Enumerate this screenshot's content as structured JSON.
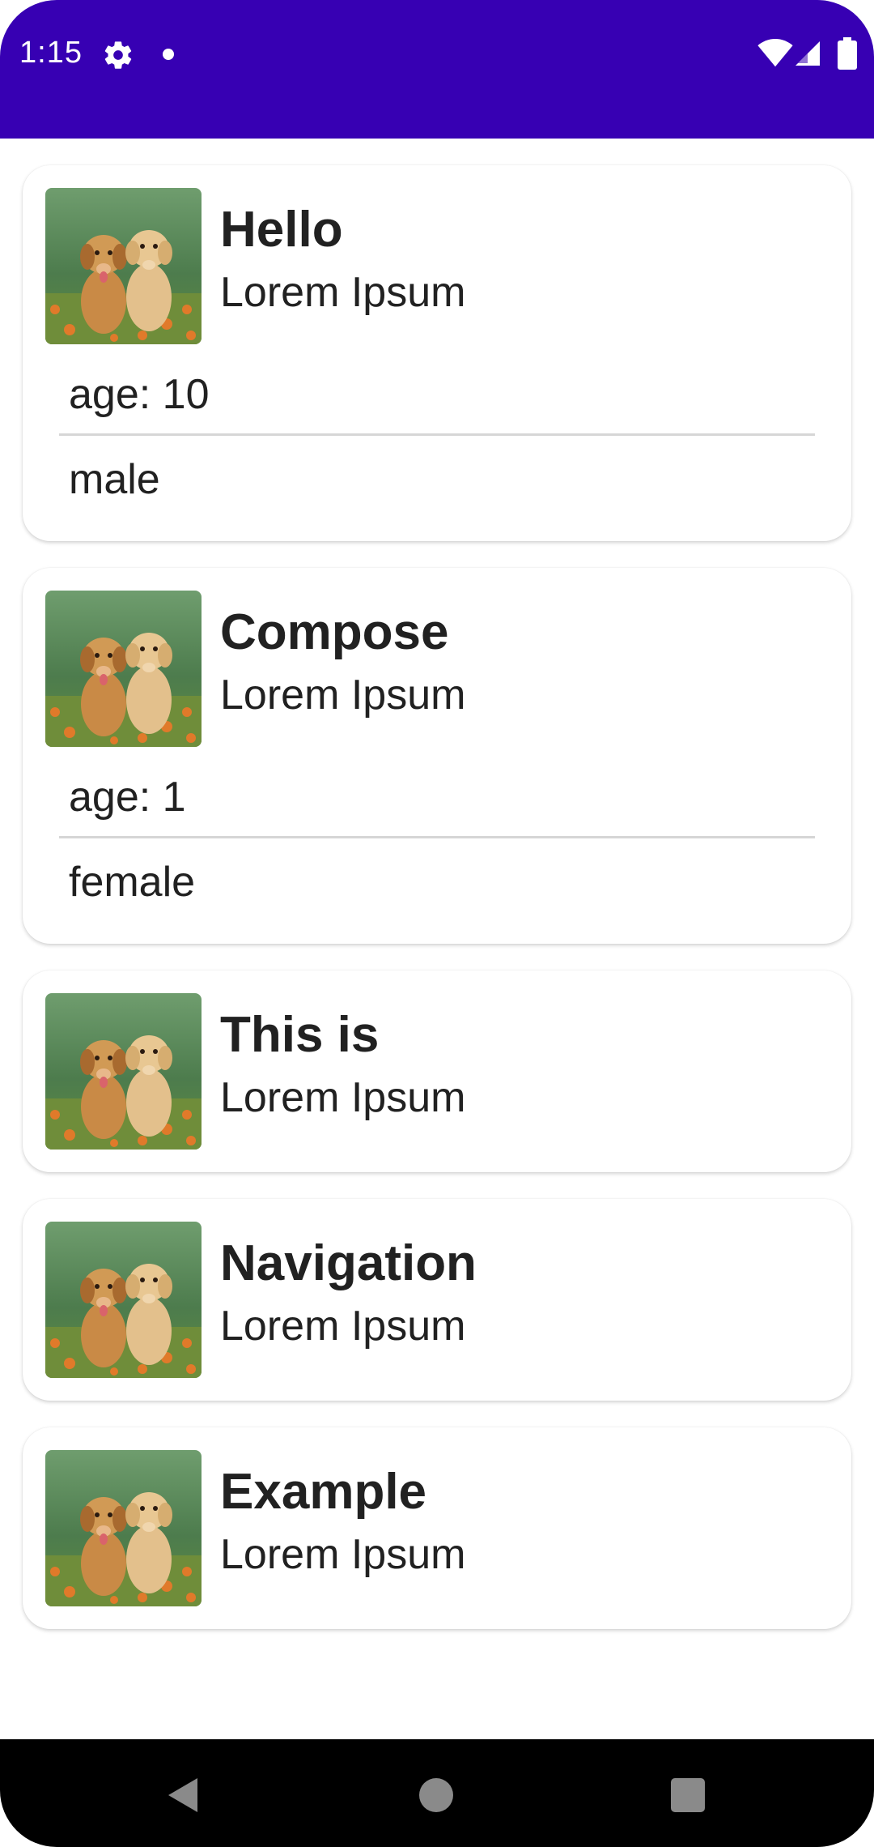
{
  "status_bar": {
    "time": "1:15",
    "icons": [
      "gear-icon",
      "notification-dot",
      "wifi-icon",
      "signal-icon",
      "battery-icon"
    ],
    "background_color": "#3700B3"
  },
  "cards": [
    {
      "title": "Hello",
      "subtitle": "Lorem Ipsum",
      "age": "age: 10",
      "gender": "male",
      "expanded": true
    },
    {
      "title": "Compose",
      "subtitle": "Lorem Ipsum",
      "age": "age: 1",
      "gender": "female",
      "expanded": true
    },
    {
      "title": "This is",
      "subtitle": "Lorem Ipsum",
      "expanded": false
    },
    {
      "title": "Navigation",
      "subtitle": "Lorem Ipsum",
      "expanded": false
    },
    {
      "title": "Example",
      "subtitle": "Lorem Ipsum",
      "expanded": false
    }
  ],
  "nav_bar": {
    "icons": [
      "back-icon",
      "home-icon",
      "recents-icon"
    ]
  }
}
